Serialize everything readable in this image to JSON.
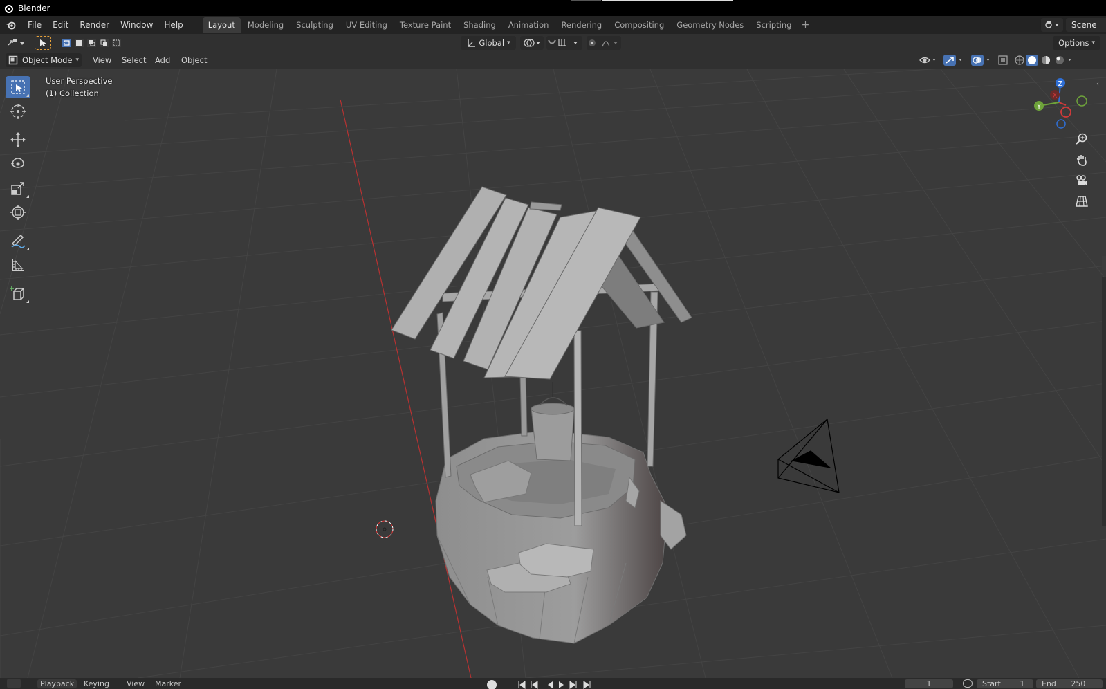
{
  "app": {
    "title": "Blender"
  },
  "menu": {
    "items": [
      "File",
      "Edit",
      "Render",
      "Window",
      "Help"
    ]
  },
  "workspaces": {
    "tabs": [
      "Layout",
      "Modeling",
      "Sculpting",
      "UV Editing",
      "Texture Paint",
      "Shading",
      "Animation",
      "Rendering",
      "Compositing",
      "Geometry Nodes",
      "Scripting"
    ],
    "active": "Layout",
    "add_symbol": "+"
  },
  "scene": {
    "label": "Scene"
  },
  "tool_header": {
    "orientation": "Global",
    "options_label": "Options"
  },
  "viewport_header": {
    "mode": "Object Mode",
    "menus": [
      "View",
      "Select",
      "Add",
      "Object"
    ]
  },
  "viewport": {
    "perspective": "User Perspective",
    "collection": "(1) Collection"
  },
  "gizmo": {
    "z": "Z",
    "x": "X",
    "y": "Y"
  },
  "toolbar": {
    "tools": [
      "select-box-icon",
      "cursor-icon",
      "move-icon",
      "rotate-icon",
      "scale-icon",
      "transform-icon",
      "annotate-icon",
      "measure-icon",
      "add-cube-icon"
    ]
  },
  "timeline": {
    "playback": "Playback",
    "keying": "Keying",
    "view": "View",
    "marker": "Marker",
    "current_frame": "1",
    "start_label": "Start",
    "start_value": "1",
    "end_label": "End",
    "end_value": "250"
  },
  "colors": {
    "accent": "#4772b3",
    "x_axis": "#d03a3a",
    "y_axis": "#6ea33a",
    "z_axis": "#2f6fd6",
    "viewport_bg": "#3a3a3a"
  }
}
